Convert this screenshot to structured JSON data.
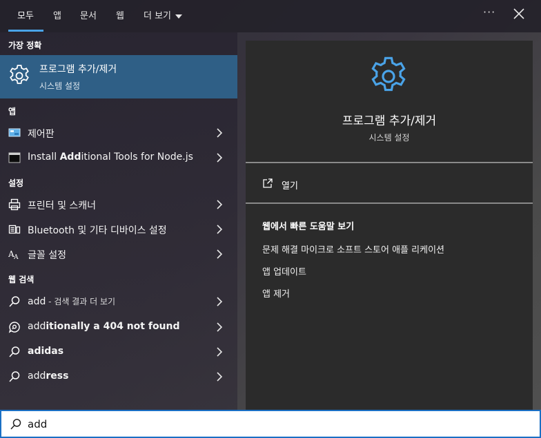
{
  "tabs": [
    {
      "label": "모두"
    },
    {
      "label": "앱"
    },
    {
      "label": "문서"
    },
    {
      "label": "웹"
    },
    {
      "label": "더 보기"
    }
  ],
  "topbar": {
    "more_label": "···"
  },
  "left": {
    "best_match_header": "가장 정확",
    "best_match": {
      "title": "프로그램 추가/제거",
      "subtitle": "시스템 설정",
      "icon": "gear-icon"
    },
    "apps_header": "앱",
    "apps": [
      {
        "label": "제어판",
        "icon": "control-panel-icon"
      },
      {
        "pre": "Install ",
        "bold": "Add",
        "post": "itional Tools for Node.js",
        "icon": "terminal-icon"
      }
    ],
    "settings_header": "설정",
    "settings": [
      {
        "label": "프린터 및 스캐너",
        "icon": "printer-icon"
      },
      {
        "label": "Bluetooth 및 기타 디바이스 설정",
        "icon": "devices-icon"
      },
      {
        "label": "글꼴 설정",
        "icon": "font-icon"
      }
    ],
    "web_header": "웹 검색",
    "web": [
      {
        "pre": "add",
        "bold": "",
        "dim": " - 검색 결과 더 보기",
        "icon": "search-icon"
      },
      {
        "pre": "add",
        "bold": "itionally a 404 not found",
        "dim": "",
        "icon": "chat-search-icon"
      },
      {
        "pre": "",
        "bold": "adidas",
        "dim": "",
        "icon": "search-icon"
      },
      {
        "pre": "add",
        "bold": "ress",
        "dim": "",
        "icon": "search-icon"
      }
    ]
  },
  "right": {
    "title": "프로그램 추가/제거",
    "subtitle": "시스템 설정",
    "open_label": "열기",
    "web_help_header": "웹에서 빠른 도움말 보기",
    "web_help_items": [
      "문제 해결 마이크로 소프트 스토어 애플 리케이션",
      "앱 업데이트",
      "앱 제거"
    ]
  },
  "search": {
    "value": "add"
  },
  "colors": {
    "accent": "#4aa3e8",
    "selected": "#2f5f86",
    "gear": "#4aa3e8"
  }
}
